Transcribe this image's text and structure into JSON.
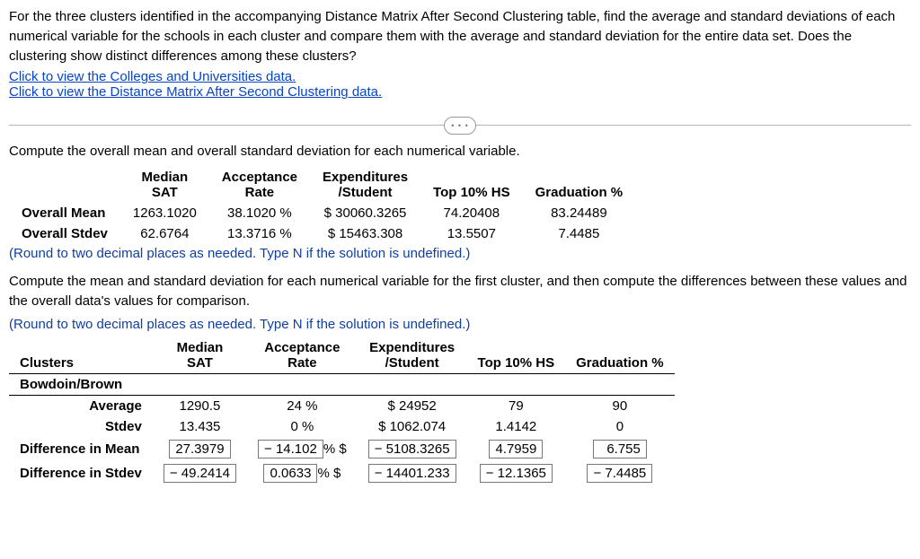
{
  "intro": "For the three clusters identified in the accompanying Distance Matrix After Second Clustering table, find the average and standard deviations of each numerical variable for the schools in each cluster and compare them with the average and standard deviation for the entire data set. Does the clustering show distinct differences among these clusters?",
  "links": {
    "data1": "Click to view the Colleges and Universities data.",
    "data2": "Click to view the Distance Matrix After Second Clustering data."
  },
  "collapse_glyph": "• • •",
  "section1": "Compute the overall mean and overall standard deviation for each numerical variable.",
  "headers": {
    "median_sat_l1": "Median",
    "median_sat_l2": "SAT",
    "accept_l1": "Acceptance",
    "accept_l2": "Rate",
    "expend_l1": "Expenditures",
    "expend_l2": "/Student",
    "top10": "Top 10% HS",
    "grad": "Graduation %"
  },
  "overall": {
    "mean_label": "Overall Mean",
    "stdev_label": "Overall Stdev",
    "mean": {
      "sat": "1263.1020",
      "accept": "38.1020 %",
      "expend": "$ 30060.3265",
      "top10": "74.20408",
      "grad": "83.24489"
    },
    "stdev": {
      "sat": "62.6764",
      "accept": "13.3716 %",
      "expend": "$ 15463.308",
      "top10": "13.5507",
      "grad": "7.4485"
    }
  },
  "hint1": "(Round to two decimal places as needed. Type N if the solution is undefined.)",
  "section2": "Compute the mean and standard deviation for each numerical variable for the first cluster, and then compute the differences between these values and the overall data's values for comparison.",
  "hint2": "(Round to two decimal places as needed. Type N if the solution is undefined.)",
  "clusters_label": "Clusters",
  "cluster1": {
    "name": "Bowdoin/Brown",
    "avg_label": "Average",
    "stdev_label": "Stdev",
    "diff_mean_label": "Difference in Mean",
    "diff_stdev_label": "Difference in Stdev",
    "avg": {
      "sat": "1290.5",
      "accept": "24 %",
      "expend": "$ 24952",
      "top10": "79",
      "grad": "90"
    },
    "stdev": {
      "sat": "13.435",
      "accept": "0 %",
      "expend": "$ 1062.074",
      "top10": "1.4142",
      "grad": "0"
    },
    "dmean": {
      "sat": "27.3979",
      "accept_box": "− 14.102",
      "accept_suffix": "% $",
      "expend": "− 5108.3265",
      "top10": "4.7959",
      "grad": "6.755"
    },
    "dstdev": {
      "sat": "− 49.2414",
      "accept_box": "0.0633",
      "accept_suffix": "% $",
      "expend": "− 14401.233",
      "top10": "− 12.1365",
      "grad": "− 7.4485"
    }
  },
  "chart_data": {
    "type": "table",
    "title": "Overall vs Cluster Bowdoin/Brown statistics",
    "columns": [
      "Median SAT",
      "Acceptance Rate (%)",
      "Expenditures/Student ($)",
      "Top 10% HS",
      "Graduation %"
    ],
    "rows": [
      {
        "name": "Overall Mean",
        "values": [
          1263.102,
          38.102,
          30060.3265,
          74.20408,
          83.24489
        ]
      },
      {
        "name": "Overall Stdev",
        "values": [
          62.6764,
          13.3716,
          15463.308,
          13.5507,
          7.4485
        ]
      },
      {
        "name": "Bowdoin/Brown Average",
        "values": [
          1290.5,
          24,
          24952,
          79,
          90
        ]
      },
      {
        "name": "Bowdoin/Brown Stdev",
        "values": [
          13.435,
          0,
          1062.074,
          1.4142,
          0
        ]
      },
      {
        "name": "Difference in Mean",
        "values": [
          27.3979,
          -14.102,
          -5108.3265,
          4.7959,
          6.755
        ]
      },
      {
        "name": "Difference in Stdev",
        "values": [
          -49.2414,
          0.0633,
          -14401.233,
          -12.1365,
          -7.4485
        ]
      }
    ]
  }
}
